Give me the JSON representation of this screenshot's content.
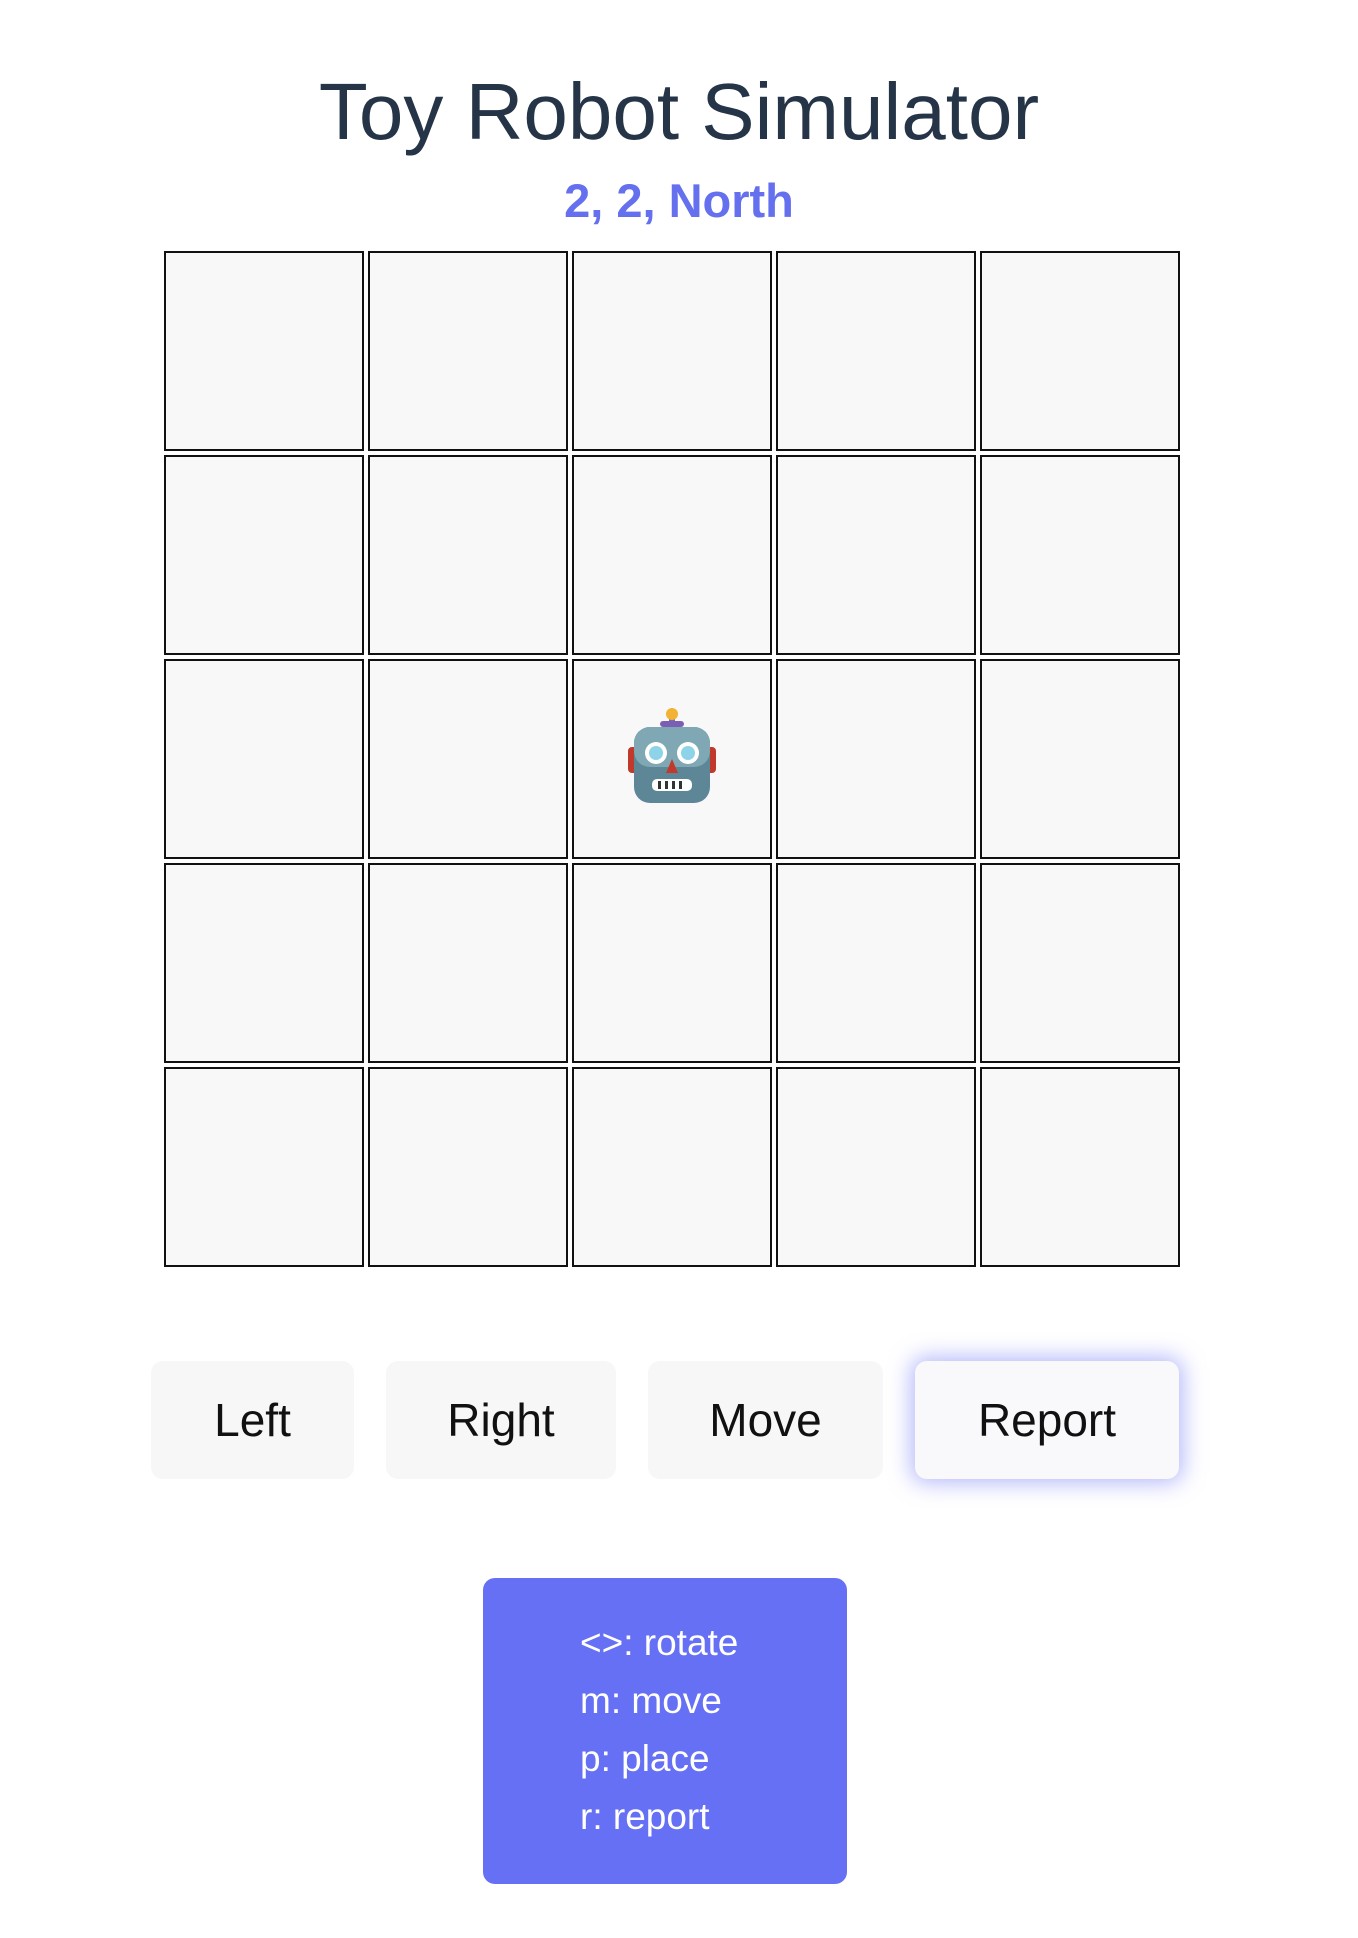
{
  "title": "Toy Robot Simulator",
  "status": "2, 2, North",
  "board": {
    "columns": 5,
    "rows": 5,
    "robot_position": {
      "x": 2,
      "y": 2
    },
    "robot_facing": "North",
    "robot_icon": "robot-face-icon"
  },
  "controls": {
    "left_label": "Left",
    "right_label": "Right",
    "move_label": "Move",
    "report_label": "Report"
  },
  "help": {
    "lines": [
      "<>: rotate",
      "m: move",
      "p: place",
      "r: report"
    ]
  },
  "colors": {
    "title": "#253447",
    "status": "#6570ee",
    "help_background": "#6570f4",
    "cell_background": "#f8f8f8",
    "cell_border": "#111111",
    "button_background": "#f7f7f7"
  }
}
